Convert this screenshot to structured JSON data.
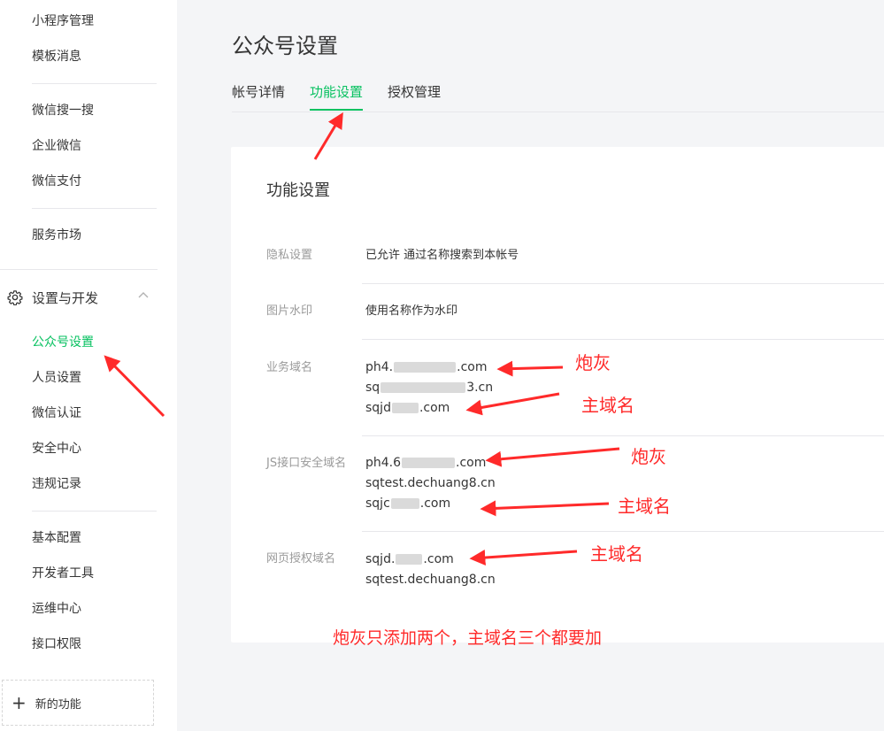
{
  "sidebar": {
    "items_top": [
      "小程序管理",
      "模板消息"
    ],
    "items_mid": [
      "微信搜一搜",
      "企业微信",
      "微信支付"
    ],
    "market": "服务市场",
    "section": {
      "title": "设置与开发",
      "icon": "gear-icon"
    },
    "items_settings": [
      "公众号设置",
      "人员设置",
      "微信认证",
      "安全中心",
      "违规记录"
    ],
    "items_dev": [
      "基本配置",
      "开发者工具",
      "运维中心",
      "接口权限"
    ],
    "new_feature": "新的功能"
  },
  "page": {
    "title": "公众号设置",
    "tabs": [
      "帐号详情",
      "功能设置",
      "授权管理"
    ],
    "active_tab": "功能设置"
  },
  "card": {
    "title": "功能设置",
    "privacy": {
      "label": "隐私设置",
      "value": "已允许 通过名称搜索到本帐号"
    },
    "watermark": {
      "label": "图片水印",
      "value": "使用名称作为水印"
    },
    "business_domain": {
      "label": "业务域名",
      "d1_prefix": "ph4.",
      "d1_suffix": ".com",
      "d2_prefix": "sq",
      "d2_suffix": "3.cn",
      "d3_prefix": "sqjd",
      "d3_suffix": ".com"
    },
    "js_domain": {
      "label": "JS接口安全域名",
      "d1_prefix": "ph4.6",
      "d1_suffix": ".com",
      "d2": "sqtest.dechuang8.cn",
      "d3_prefix": "sqjc",
      "d3_suffix": ".com"
    },
    "auth_domain": {
      "label": "网页授权域名",
      "d1_prefix": "sqjd.",
      "d1_suffix": ".com",
      "d2": "sqtest.dechuang8.cn"
    }
  },
  "annotations": {
    "paohui": "炮灰",
    "main_domain": "主域名",
    "note": "炮灰只添加两个，主域名三个都要加",
    "color": "#ff2a2a"
  },
  "colors": {
    "accent": "#07c160",
    "text": "#353535",
    "muted": "#9a9a9a",
    "bg": "#f4f5f7"
  }
}
